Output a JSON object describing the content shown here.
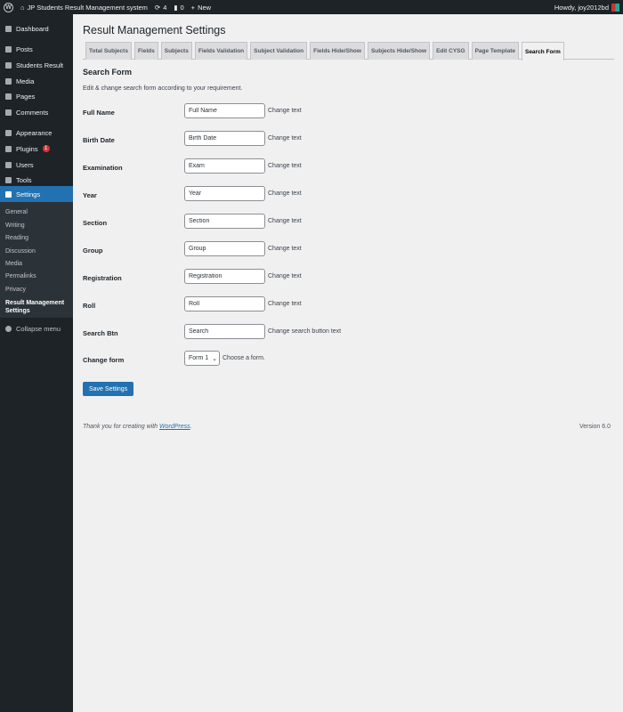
{
  "adminbar": {
    "site": "JP Students Result Management system",
    "updates": "4",
    "comments": "0",
    "new": "New",
    "howdy": "Howdy, joy2012bd"
  },
  "sidebar": {
    "items": [
      {
        "label": "Dashboard",
        "icon": "dashboard-icon"
      },
      {
        "label": "Posts",
        "icon": "pin-icon"
      },
      {
        "label": "Students Result",
        "icon": "database-icon"
      },
      {
        "label": "Media",
        "icon": "media-icon"
      },
      {
        "label": "Pages",
        "icon": "pages-icon"
      },
      {
        "label": "Comments",
        "icon": "comment-icon"
      },
      {
        "label": "Appearance",
        "icon": "brush-icon"
      },
      {
        "label": "Plugins",
        "icon": "plugin-icon",
        "badge": "1"
      },
      {
        "label": "Users",
        "icon": "users-icon"
      },
      {
        "label": "Tools",
        "icon": "wrench-icon"
      },
      {
        "label": "Settings",
        "icon": "settings-icon",
        "active": true
      }
    ],
    "submenu": [
      "General",
      "Writing",
      "Reading",
      "Discussion",
      "Media",
      "Permalinks",
      "Privacy",
      "Result Management Settings"
    ],
    "collapse": "Collapse menu"
  },
  "page": {
    "title": "Result Management Settings",
    "tabs": [
      "Total Subjects",
      "Fields",
      "Subjects",
      "Fields Validation",
      "Subject Validation",
      "Fields Hide/Show",
      "Subjects Hide/Show",
      "Edit CYSG",
      "Page Template",
      "Search Form"
    ],
    "active_tab": "Search Form",
    "section_title": "Search Form",
    "description": "Edit & change search form according to your requirement.",
    "fields": [
      {
        "label": "Full Name",
        "value": "Full Name",
        "hint": "Change text"
      },
      {
        "label": "Birth Date",
        "value": "Birth Date",
        "hint": "Change text"
      },
      {
        "label": "Examination",
        "value": "Exam",
        "hint": "Change text"
      },
      {
        "label": "Year",
        "value": "Year",
        "hint": "Change text"
      },
      {
        "label": "Section",
        "value": "Section",
        "hint": "Change text"
      },
      {
        "label": "Group",
        "value": "Group",
        "hint": "Change text"
      },
      {
        "label": "Registration",
        "value": "Registration",
        "hint": "Change text"
      },
      {
        "label": "Roll",
        "value": "Roll",
        "hint": "Change text"
      },
      {
        "label": "Search Btn",
        "value": "Search",
        "hint": "Change search button text"
      }
    ],
    "change_form": {
      "label": "Change form",
      "value": "Form 1",
      "hint": "Choose a form."
    },
    "save": "Save Settings",
    "footer_text": "Thank you for creating with ",
    "footer_link": "WordPress",
    "footer_end": ".",
    "version": "Version 6.0"
  }
}
